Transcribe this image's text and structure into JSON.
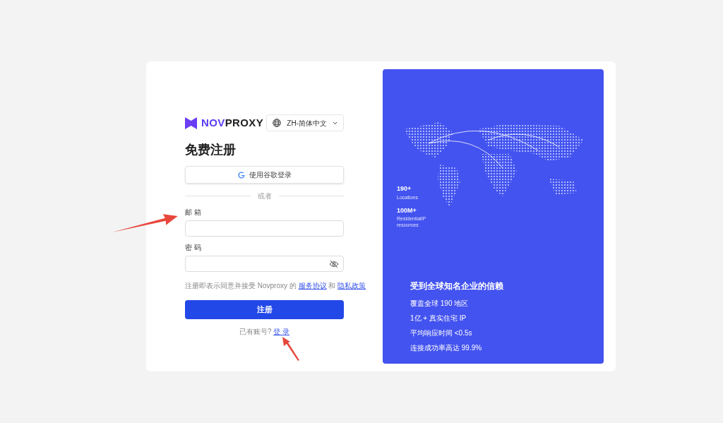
{
  "brand": {
    "name_part1": "NOV",
    "name_part2": "PROXY"
  },
  "language": {
    "label": "ZH-简体中文"
  },
  "title": "免费注册",
  "google_button": {
    "label": "使用谷歌登录"
  },
  "divider": "或者",
  "fields": [
    {
      "kind": "text",
      "label": "邮 箱"
    },
    {
      "kind": "password",
      "label": "密 码"
    }
  ],
  "terms": {
    "text": "注册即表示同意并接受 Novproxy 的",
    "link1": "服务协议",
    "and": "和",
    "link2": "隐私政策"
  },
  "submit": "注册",
  "login_prompt": {
    "text": "已有账号?",
    "link": "登 录"
  },
  "stats": [
    {
      "value": "190+",
      "label": "Locations"
    },
    {
      "value": "100M+",
      "label": "ResidentialIP resources"
    }
  ],
  "trust": {
    "heading": "受到全球知名企业的信赖",
    "items": [
      "覆盖全球 190 地区",
      "1亿 + 真实住宅 IP",
      "平均响应时间 <0.5s",
      "连接成功率高达 99.9%"
    ]
  }
}
